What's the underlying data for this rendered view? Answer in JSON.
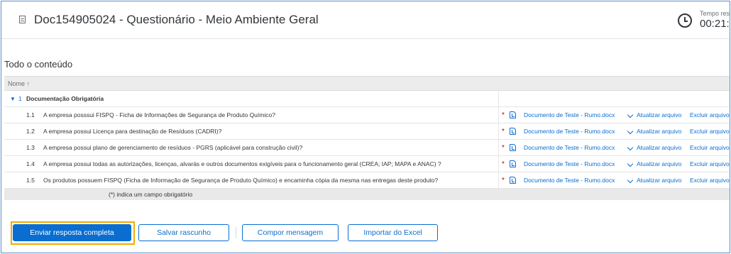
{
  "header": {
    "title": "Doc154905024 - Questionário - Meio Ambiente Geral",
    "time_label": "Tempo resta",
    "time_value": "00:21:1"
  },
  "section_title": "Todo o conteúdo",
  "table": {
    "column_header": "Nome ↑",
    "group": {
      "caret": "▼",
      "number": "1",
      "name": "Documentação Obrigatória"
    },
    "questions": [
      {
        "number": "1.1",
        "text": "A empresa posssui FISPQ - Ficha de Informações de Segurança de Produto Químico?",
        "required": "*",
        "file": "Documento de Teste - Rumo.docx",
        "update": "Atualizar arquivo",
        "delete": "Excluir arquivo"
      },
      {
        "number": "1.2",
        "text": "A empresa possui Licença para destinação de Resíduos (CADRI)?",
        "required": "*",
        "file": "Documento de Teste - Rumo.docx",
        "update": "Atualizar arquivo",
        "delete": "Excluir arquivo"
      },
      {
        "number": "1.3",
        "text": "A empresa possui plano de gerenciamento de resíduos - PGRS (aplicável para construção civil)?",
        "required": "*",
        "file": "Documento de Teste - Rumo.docx",
        "update": "Atualizar arquivo",
        "delete": "Excluir arquivo"
      },
      {
        "number": "1.4",
        "text": "A empresa possui todas as autorizações, licenças, alvarás e outros documentos exigíveis para o funcionamento geral (CREA; IAP; MAPA e ANAC) ?",
        "required": "*",
        "file": "Documento de Teste - Rumo.docx",
        "update": "Atualizar arquivo",
        "delete": "Excluir arquivo"
      },
      {
        "number": "1.5",
        "text": "Os produtos possuem FISPQ (Ficha de Informação de Segurança de Produto Químico) e encaminha cópia da mesma nas entregas deste produto?",
        "required": "*",
        "file": "Documento de Teste - Rumo.docx",
        "update": "Atualizar arquivo",
        "delete": "Excluir arquivo"
      }
    ],
    "footnote": "(*) indica um campo obrigatório"
  },
  "buttons": {
    "submit": "Enviar resposta completa",
    "draft": "Salvar rascunho",
    "compose": "Compor mensagem",
    "import": "Importar do Excel"
  },
  "colors": {
    "accent": "#0a6ed1",
    "highlight": "#f0ab00",
    "required": "#bb0000"
  }
}
